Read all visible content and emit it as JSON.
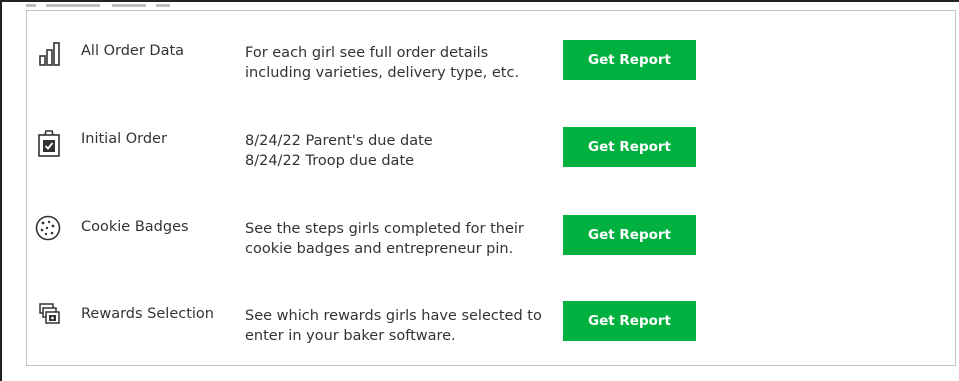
{
  "reports": [
    {
      "icon": "bar-chart-icon",
      "label": "All Order Data",
      "desc_lines": [
        "For each girl see full order details",
        "including varieties, delivery type, etc."
      ],
      "button_label": "Get Report"
    },
    {
      "icon": "clipboard-check-icon",
      "label": "Initial Order",
      "desc_lines": [
        "8/24/22 Parent's due date",
        "8/24/22 Troop due date"
      ],
      "button_label": "Get Report"
    },
    {
      "icon": "cookie-icon",
      "label": "Cookie Badges",
      "desc_lines": [
        "See the steps girls completed for their",
        "cookie badges and entrepreneur pin."
      ],
      "button_label": "Get Report"
    },
    {
      "icon": "rewards-icon",
      "label": "Rewards Selection",
      "desc_lines": [
        "See which rewards girls have selected to",
        "enter in your baker software."
      ],
      "button_label": "Get Report"
    }
  ],
  "colors": {
    "button_bg": "#00b140",
    "button_text": "#ffffff",
    "text": "#333333",
    "panel_border": "#c4c4c4"
  }
}
